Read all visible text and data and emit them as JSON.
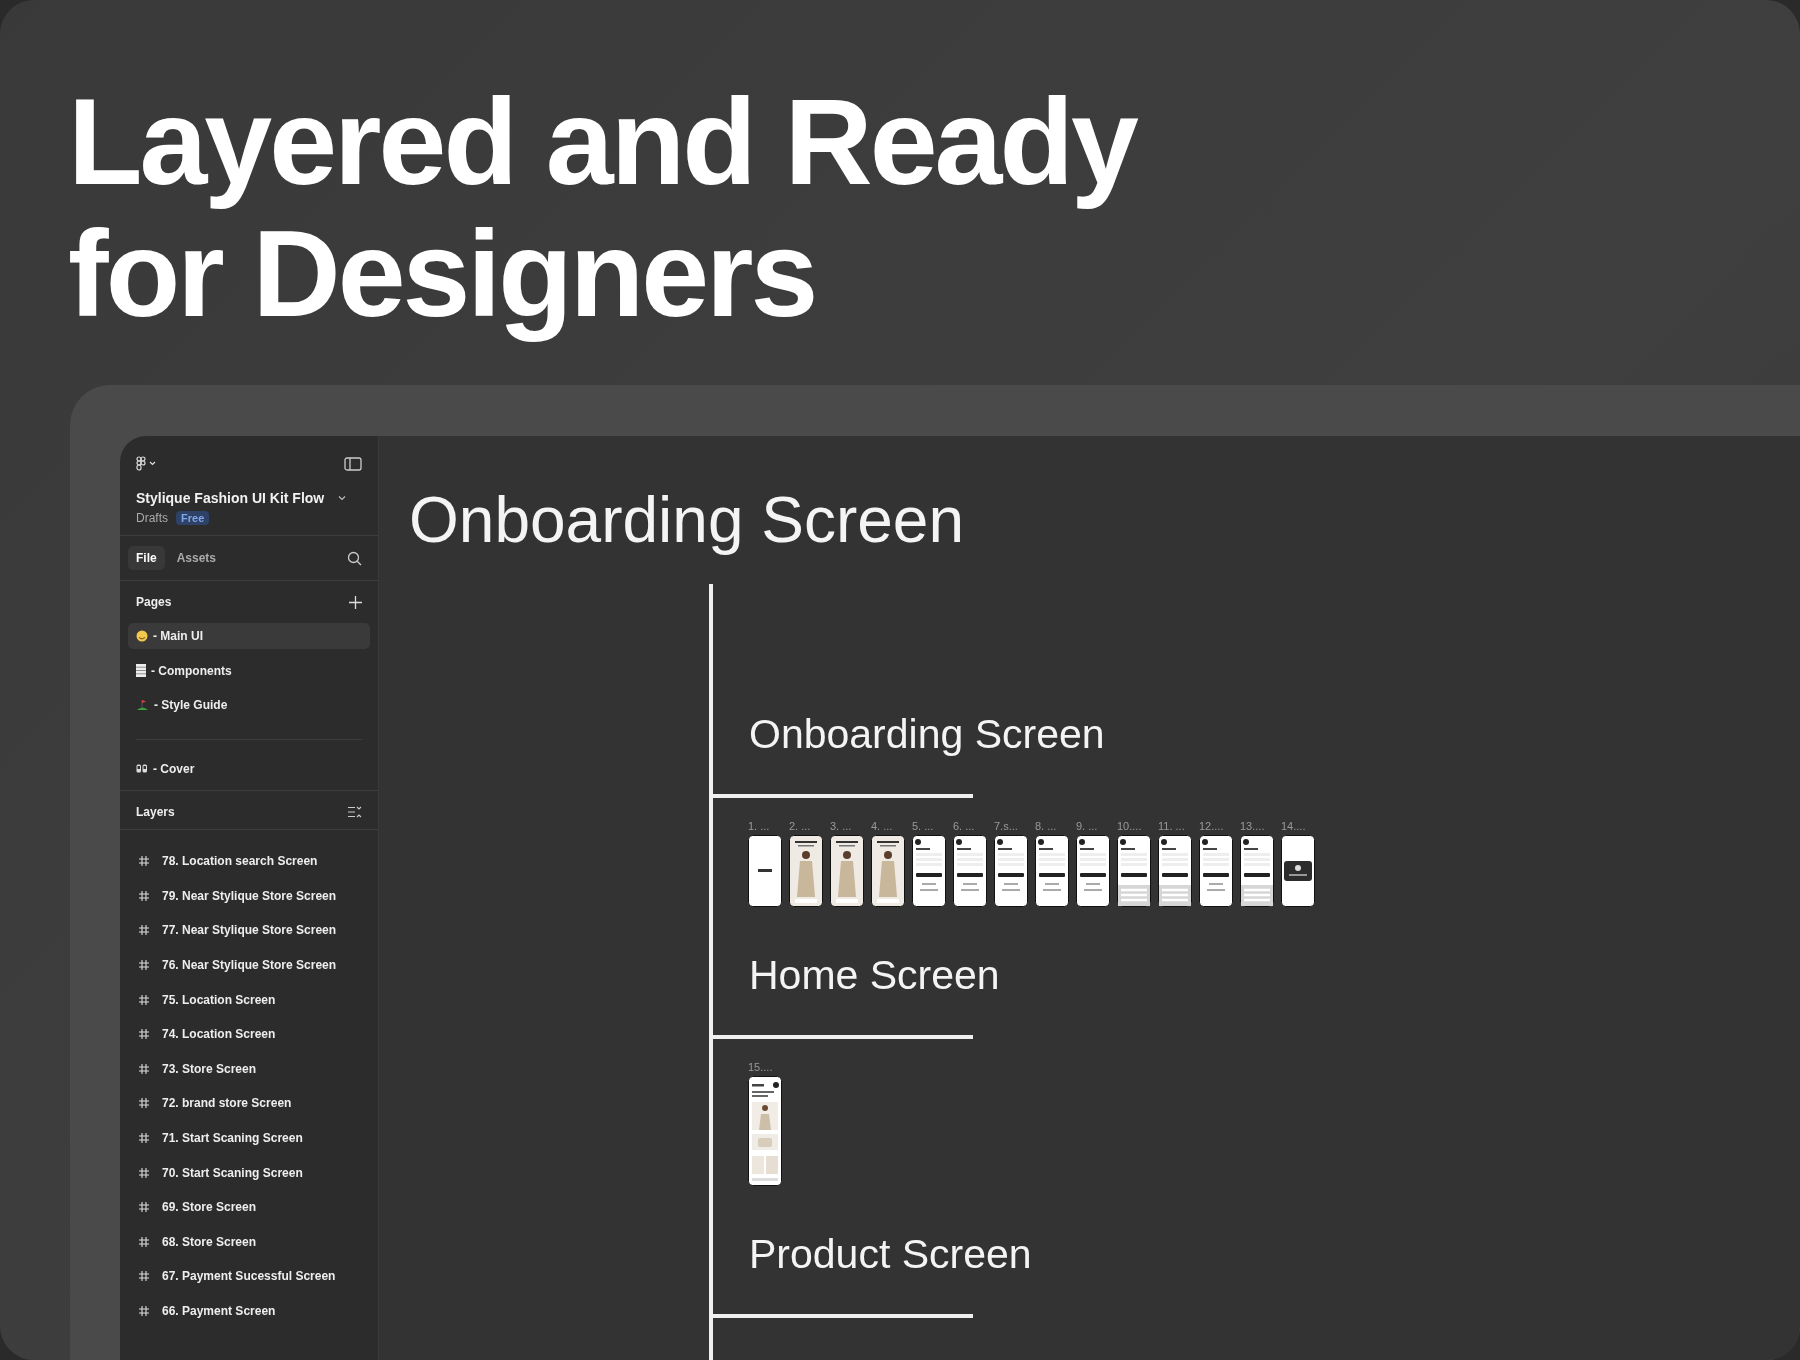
{
  "headline": [
    "Layered and Ready",
    "for Designers"
  ],
  "sidebar": {
    "file_title": "Stylique Fashion UI Kit Flow",
    "location": "Drafts",
    "plan_badge": "Free",
    "tabs": [
      {
        "label": "File",
        "selected": true
      },
      {
        "label": "Assets",
        "selected": false
      }
    ],
    "pages_heading": "Pages",
    "page_groups": [
      [
        {
          "label": "- Main UI",
          "selected": true
        },
        {
          "label": "- Components",
          "selected": false
        },
        {
          "label": "- Style Guide",
          "selected": false
        }
      ],
      [
        {
          "label": "- Cover",
          "selected": false
        }
      ]
    ],
    "layers_heading": "Layers",
    "layers": [
      "78. Location search Screen",
      "79. Near Stylique Store Screen",
      "77. Near Stylique Store Screen",
      "76. Near Stylique Store Screen",
      "75. Location Screen",
      "74. Location Screen",
      "73. Store Screen",
      "72. brand store Screen",
      "71. Start Scaning Screen",
      "70. Start Scaning Screen",
      "69. Store Screen",
      "68. Store Screen",
      "67. Payment Sucessful Screen",
      "66. Payment Screen"
    ]
  },
  "canvas": {
    "title": "Onboarding Screen",
    "sections": [
      {
        "title": "Onboarding Screen",
        "frames": [
          {
            "label": "1. ...",
            "kind": "splash"
          },
          {
            "label": "2. ...",
            "kind": "photo"
          },
          {
            "label": "3. ...",
            "kind": "photo"
          },
          {
            "label": "4. ...",
            "kind": "photo"
          },
          {
            "label": "5. ...",
            "kind": "form"
          },
          {
            "label": "6. ...",
            "kind": "form"
          },
          {
            "label": "7.s...",
            "kind": "form"
          },
          {
            "label": "8. ...",
            "kind": "form"
          },
          {
            "label": "9. ...",
            "kind": "form"
          },
          {
            "label": "10....",
            "kind": "keyboard"
          },
          {
            "label": "11. ...",
            "kind": "keyboard"
          },
          {
            "label": "12....",
            "kind": "form"
          },
          {
            "label": "13....",
            "kind": "keyboard"
          },
          {
            "label": "14....",
            "kind": "dialog"
          }
        ]
      },
      {
        "title": "Home Screen",
        "frames": [
          {
            "label": "15....",
            "kind": "feed"
          }
        ]
      },
      {
        "title": "Product Screen"
      }
    ]
  }
}
